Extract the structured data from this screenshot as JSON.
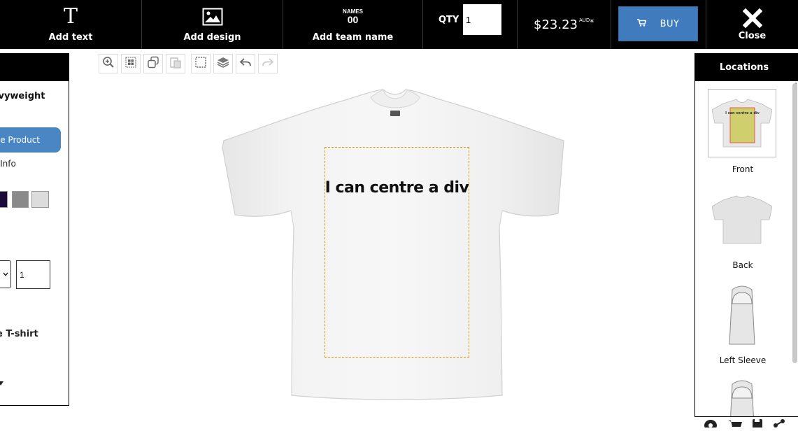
{
  "topbar": {
    "add_text": "Add text",
    "add_design": "Add design",
    "add_team_name": "Add team name",
    "team_icon_top": "NAMES",
    "team_icon_num": "00",
    "qty_label": "QTY",
    "qty_value": "1",
    "price": "$23.23",
    "price_currency": "AUD",
    "price_asterisk": "*",
    "buy_label": "BUY",
    "close_label": "Close"
  },
  "left_panel": {
    "product_name": "Heavyweight",
    "change_product": "e Product",
    "product_info": "ct Info",
    "swatches": [
      "#1b0a3a",
      "#8a8a8a",
      "#dcdcdc"
    ],
    "qty_value": "1",
    "product_type": "e T-shirt"
  },
  "canvas": {
    "design_text": "I can centre a div",
    "print_area_color": "#d49a00"
  },
  "right_panel": {
    "title": "Locations",
    "locations": [
      {
        "label": "Front",
        "selected": true
      },
      {
        "label": "Back",
        "selected": false
      },
      {
        "label": "Left Sleeve",
        "selected": false
      },
      {
        "label": "",
        "selected": false
      }
    ]
  },
  "colors": {
    "topbar_bg": "#000000",
    "buy_button": "#3f7bbd",
    "change_product_button": "#4b86c4",
    "print_area_border": "#d49a00"
  }
}
